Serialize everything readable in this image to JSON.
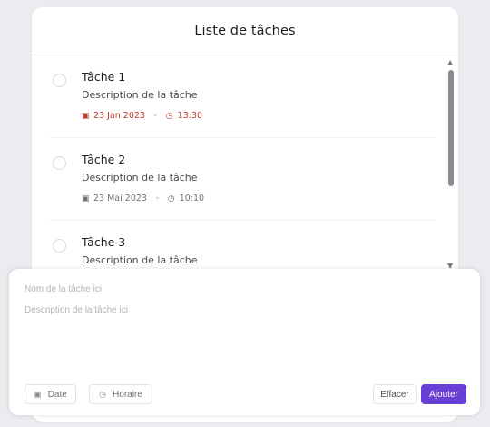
{
  "header": {
    "title": "Liste de tâches"
  },
  "tasks": [
    {
      "title": "Tâche 1",
      "description": "Description de la tâche",
      "date": "23 Jan 2023",
      "time": "13:30",
      "overdue": true
    },
    {
      "title": "Tâche 2",
      "description": "Description de la tâche",
      "date": "23 Mai 2023",
      "time": "10:10",
      "overdue": false
    },
    {
      "title": "Tâche 3",
      "description": "Description de la tâche",
      "date": "",
      "time": "",
      "overdue": false
    }
  ],
  "form": {
    "name_placeholder": "Nom de la tâche ici",
    "description_placeholder": "Description de la tâche ici",
    "date_label": "Date",
    "time_label": "Horaire",
    "clear_label": "Effacer",
    "add_label": "Ajouter"
  },
  "colors": {
    "accent": "#6a3fd6",
    "overdue": "#c0392b",
    "background": "#ececf0"
  },
  "icons": {
    "date": "calendar-icon",
    "time": "clock-icon"
  }
}
